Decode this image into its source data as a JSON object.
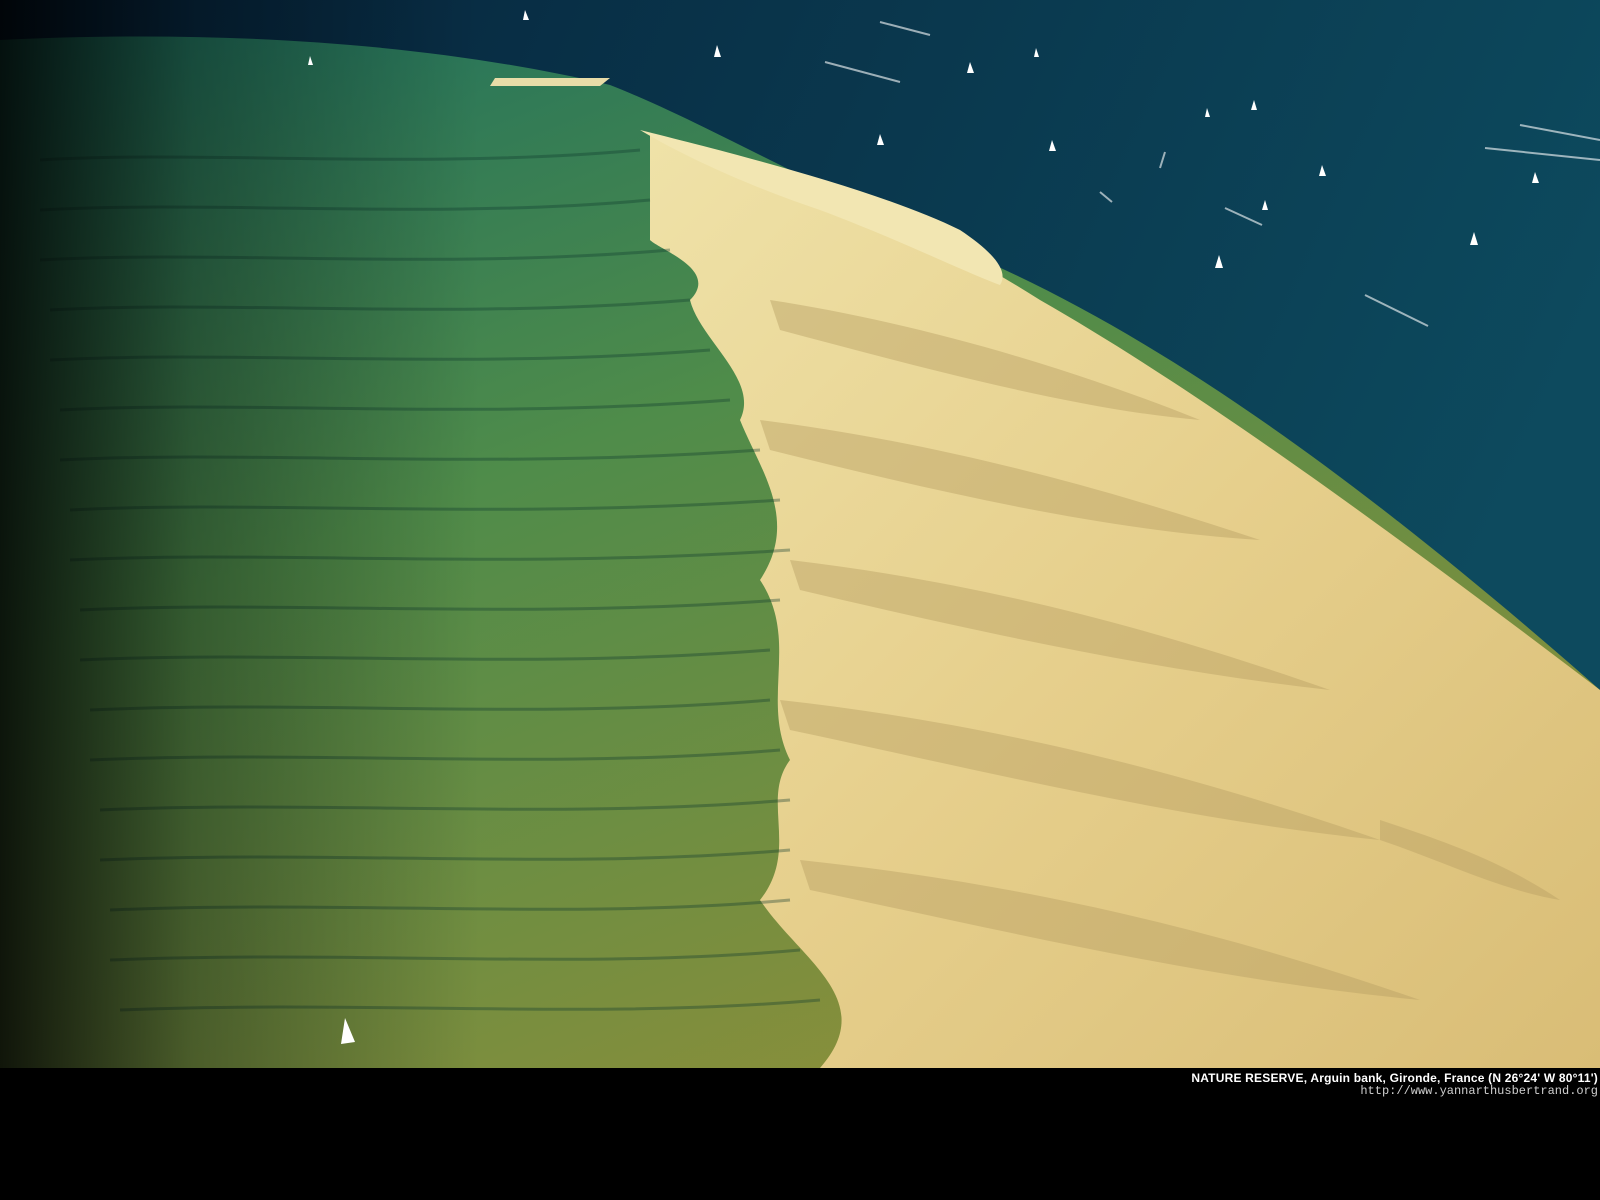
{
  "photo": {
    "subject": "",
    "colors": {
      "deep_water": "#0b3550",
      "shallow_water": "#3f8f5c",
      "green_shoal": "#7f9a3e",
      "sand": "#e9d79a",
      "sand_shadow": "#b8a36a"
    }
  },
  "caption": {
    "title": "NATURE RESERVE, Arguin bank, Gironde, France (N 26°24' W 80°11')",
    "url": "http://www.yannarthusbertrand.org"
  }
}
